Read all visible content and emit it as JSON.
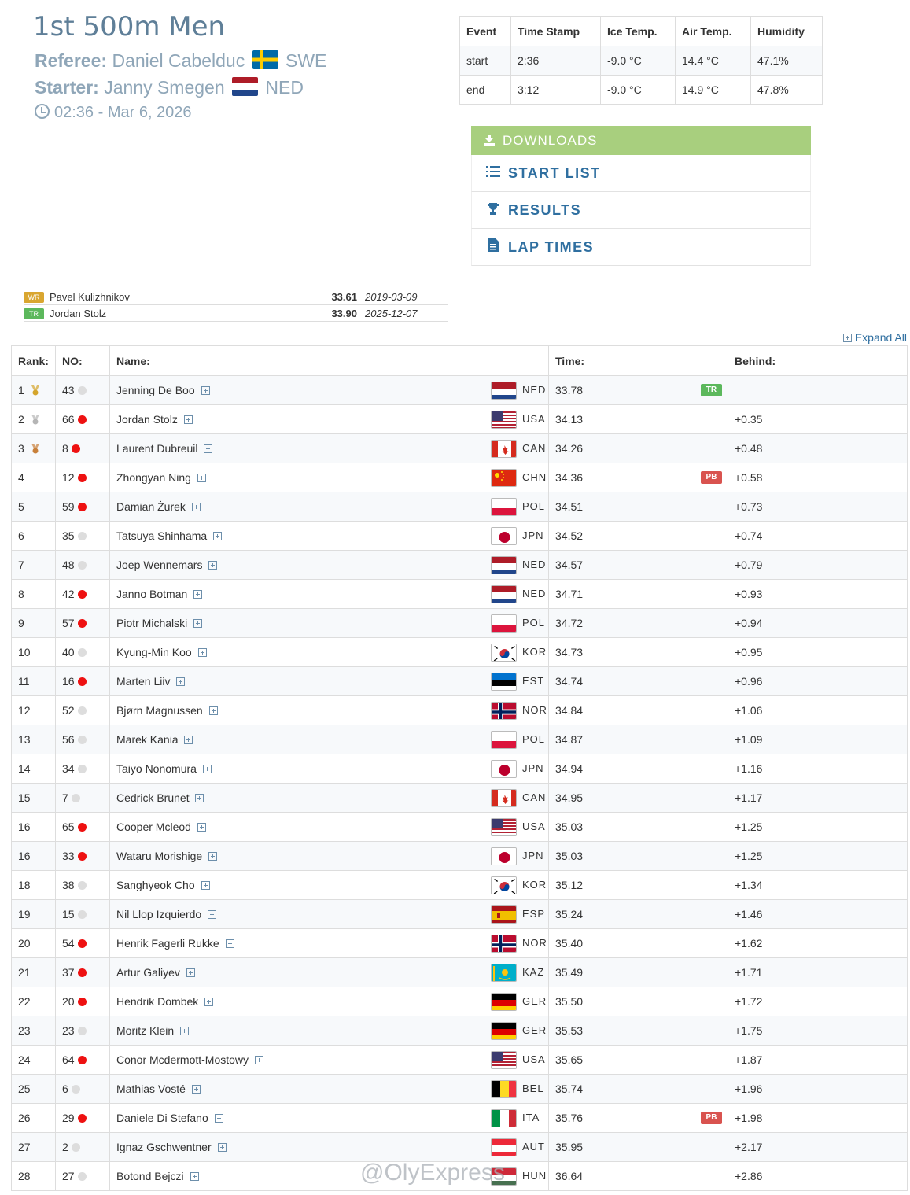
{
  "event": {
    "title": "1st 500m Men",
    "referee_label": "Referee:",
    "referee_name": "Daniel Cabelduc",
    "referee_country": "SWE",
    "starter_label": "Starter:",
    "starter_name": "Janny Smegen",
    "starter_country": "NED",
    "datetime": "02:36 - Mar 6, 2026"
  },
  "conditions": {
    "headers": [
      "Event",
      "Time Stamp",
      "Ice Temp.",
      "Air Temp.",
      "Humidity"
    ],
    "rows": [
      [
        "start",
        "2:36",
        "-9.0 °C",
        "14.4 °C",
        "47.1%"
      ],
      [
        "end",
        "3:12",
        "-9.0 °C",
        "14.9 °C",
        "47.8%"
      ]
    ]
  },
  "downloads": {
    "header": "DOWNLOADS",
    "items": [
      {
        "label": "START LIST",
        "icon": "list-icon"
      },
      {
        "label": "RESULTS",
        "icon": "trophy-icon"
      },
      {
        "label": "LAP TIMES",
        "icon": "document-icon"
      }
    ]
  },
  "records": [
    {
      "badge": "WR",
      "color": "#d9a630",
      "name": "Pavel Kulizhnikov",
      "time": "33.61",
      "date": "2019-03-09"
    },
    {
      "badge": "TR",
      "color": "#5cb85c",
      "name": "Jordan Stolz",
      "time": "33.90",
      "date": "2025-12-07"
    }
  ],
  "expand_all": "Expand All",
  "results": {
    "headers": [
      "Rank:",
      "NO:",
      "Name:",
      "Time:",
      "Behind:"
    ],
    "rows": [
      {
        "rank": "1",
        "no": "43",
        "dot": "grey",
        "medal": "gold",
        "name": "Jenning De Boo",
        "nat": "NED",
        "time": "33.78",
        "tag": "TR",
        "behind": ""
      },
      {
        "rank": "2",
        "no": "66",
        "dot": "red",
        "medal": "silver",
        "name": "Jordan Stolz",
        "nat": "USA",
        "time": "34.13",
        "tag": "",
        "behind": "+0.35"
      },
      {
        "rank": "3",
        "no": "8",
        "dot": "red",
        "medal": "bronze",
        "name": "Laurent Dubreuil",
        "nat": "CAN",
        "time": "34.26",
        "tag": "",
        "behind": "+0.48"
      },
      {
        "rank": "4",
        "no": "12",
        "dot": "red",
        "medal": "",
        "name": "Zhongyan Ning",
        "nat": "CHN",
        "time": "34.36",
        "tag": "PB",
        "behind": "+0.58"
      },
      {
        "rank": "5",
        "no": "59",
        "dot": "red",
        "medal": "",
        "name": "Damian Żurek",
        "nat": "POL",
        "time": "34.51",
        "tag": "",
        "behind": "+0.73"
      },
      {
        "rank": "6",
        "no": "35",
        "dot": "grey",
        "medal": "",
        "name": "Tatsuya Shinhama",
        "nat": "JPN",
        "time": "34.52",
        "tag": "",
        "behind": "+0.74"
      },
      {
        "rank": "7",
        "no": "48",
        "dot": "grey",
        "medal": "",
        "name": "Joep Wennemars",
        "nat": "NED",
        "time": "34.57",
        "tag": "",
        "behind": "+0.79"
      },
      {
        "rank": "8",
        "no": "42",
        "dot": "red",
        "medal": "",
        "name": "Janno Botman",
        "nat": "NED",
        "time": "34.71",
        "tag": "",
        "behind": "+0.93"
      },
      {
        "rank": "9",
        "no": "57",
        "dot": "red",
        "medal": "",
        "name": "Piotr Michalski",
        "nat": "POL",
        "time": "34.72",
        "tag": "",
        "behind": "+0.94"
      },
      {
        "rank": "10",
        "no": "40",
        "dot": "grey",
        "medal": "",
        "name": "Kyung-Min Koo",
        "nat": "KOR",
        "time": "34.73",
        "tag": "",
        "behind": "+0.95"
      },
      {
        "rank": "11",
        "no": "16",
        "dot": "red",
        "medal": "",
        "name": "Marten Liiv",
        "nat": "EST",
        "time": "34.74",
        "tag": "",
        "behind": "+0.96"
      },
      {
        "rank": "12",
        "no": "52",
        "dot": "grey",
        "medal": "",
        "name": "Bjørn Magnussen",
        "nat": "NOR",
        "time": "34.84",
        "tag": "",
        "behind": "+1.06"
      },
      {
        "rank": "13",
        "no": "56",
        "dot": "grey",
        "medal": "",
        "name": "Marek Kania",
        "nat": "POL",
        "time": "34.87",
        "tag": "",
        "behind": "+1.09"
      },
      {
        "rank": "14",
        "no": "34",
        "dot": "grey",
        "medal": "",
        "name": "Taiyo Nonomura",
        "nat": "JPN",
        "time": "34.94",
        "tag": "",
        "behind": "+1.16"
      },
      {
        "rank": "15",
        "no": "7",
        "dot": "grey",
        "medal": "",
        "name": "Cedrick Brunet",
        "nat": "CAN",
        "time": "34.95",
        "tag": "",
        "behind": "+1.17"
      },
      {
        "rank": "16",
        "no": "65",
        "dot": "red",
        "medal": "",
        "name": "Cooper Mcleod",
        "nat": "USA",
        "time": "35.03",
        "tag": "",
        "behind": "+1.25"
      },
      {
        "rank": "16",
        "no": "33",
        "dot": "red",
        "medal": "",
        "name": "Wataru Morishige",
        "nat": "JPN",
        "time": "35.03",
        "tag": "",
        "behind": "+1.25"
      },
      {
        "rank": "18",
        "no": "38",
        "dot": "grey",
        "medal": "",
        "name": "Sanghyeok Cho",
        "nat": "KOR",
        "time": "35.12",
        "tag": "",
        "behind": "+1.34"
      },
      {
        "rank": "19",
        "no": "15",
        "dot": "grey",
        "medal": "",
        "name": "Nil Llop Izquierdo",
        "nat": "ESP",
        "time": "35.24",
        "tag": "",
        "behind": "+1.46"
      },
      {
        "rank": "20",
        "no": "54",
        "dot": "red",
        "medal": "",
        "name": "Henrik Fagerli Rukke",
        "nat": "NOR",
        "time": "35.40",
        "tag": "",
        "behind": "+1.62"
      },
      {
        "rank": "21",
        "no": "37",
        "dot": "red",
        "medal": "",
        "name": "Artur Galiyev",
        "nat": "KAZ",
        "time": "35.49",
        "tag": "",
        "behind": "+1.71"
      },
      {
        "rank": "22",
        "no": "20",
        "dot": "red",
        "medal": "",
        "name": "Hendrik Dombek",
        "nat": "GER",
        "time": "35.50",
        "tag": "",
        "behind": "+1.72"
      },
      {
        "rank": "23",
        "no": "23",
        "dot": "grey",
        "medal": "",
        "name": "Moritz Klein",
        "nat": "GER",
        "time": "35.53",
        "tag": "",
        "behind": "+1.75"
      },
      {
        "rank": "24",
        "no": "64",
        "dot": "red",
        "medal": "",
        "name": "Conor Mcdermott-Mostowy",
        "nat": "USA",
        "time": "35.65",
        "tag": "",
        "behind": "+1.87"
      },
      {
        "rank": "25",
        "no": "6",
        "dot": "grey",
        "medal": "",
        "name": "Mathias Vosté",
        "nat": "BEL",
        "time": "35.74",
        "tag": "",
        "behind": "+1.96"
      },
      {
        "rank": "26",
        "no": "29",
        "dot": "red",
        "medal": "",
        "name": "Daniele Di Stefano",
        "nat": "ITA",
        "time": "35.76",
        "tag": "PB",
        "behind": "+1.98"
      },
      {
        "rank": "27",
        "no": "2",
        "dot": "grey",
        "medal": "",
        "name": "Ignaz Gschwentner",
        "nat": "AUT",
        "time": "35.95",
        "tag": "",
        "behind": "+2.17"
      },
      {
        "rank": "28",
        "no": "27",
        "dot": "grey",
        "medal": "",
        "name": "Botond Bejczi",
        "nat": "HUN",
        "time": "36.64",
        "tag": "",
        "behind": "+2.86"
      }
    ]
  },
  "colors": {
    "red_dot": "#ee1111",
    "grey_dot": "#dddddd",
    "tr_tag": "#5cb85c",
    "pb_tag": "#d9534f",
    "gold": "#d4a52c",
    "silver": "#b5b5b5",
    "bronze": "#c8803a"
  },
  "watermark": "@OlyExpress"
}
